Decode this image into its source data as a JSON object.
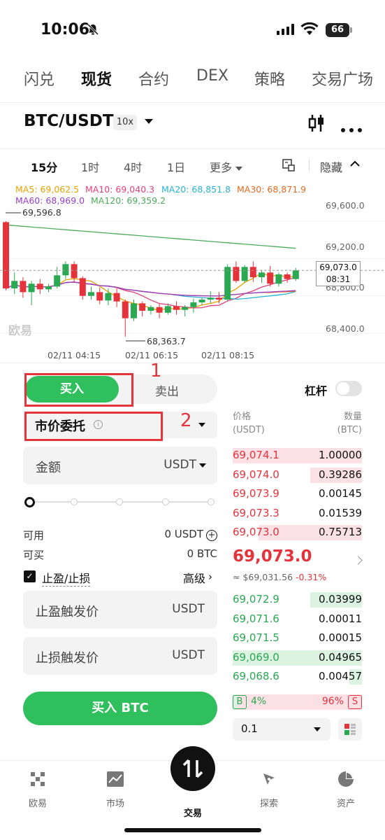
{
  "status_bar": {
    "time": "10:06",
    "battery": "66"
  },
  "top_tabs": [
    "闪兑",
    "现货",
    "合约",
    "DEX",
    "策略",
    "交易广场"
  ],
  "header": {
    "pair": "BTC/USDT",
    "leverage": "10x"
  },
  "timeframes": {
    "items": [
      "15分",
      "1时",
      "4时",
      "1日",
      "更多"
    ],
    "hide_label": "隐藏"
  },
  "ma_legend": {
    "ma5": "MA5: 69,062.5",
    "ma10": "MA10: 69,040.3",
    "ma20": "MA20: 68,851.8",
    "ma30": "MA30: 68,871.9",
    "ma60": "MA60: 68,969.0",
    "ma120": "MA120: 69,359.2"
  },
  "colors": {
    "up": "#2aa852",
    "down": "#e5333b",
    "accent": "#2fbf5c",
    "annotation": "#e5333b"
  },
  "chart_data": {
    "type": "candlestick",
    "y_ticks": [
      "69,600.0",
      "69,200.0",
      "68,800.0",
      "68,400.0"
    ],
    "x_ticks": [
      "02/11 04:15",
      "02/11 06:15",
      "02/11 08:15"
    ],
    "ylim": [
      68250,
      69750
    ],
    "high_label": "69,596.8",
    "low_label": "68,363.7",
    "current_price": "69,073.0",
    "countdown": "08:31",
    "watermark": "欧易",
    "candles": [
      {
        "o": 69590,
        "h": 69600,
        "c": 68880,
        "l": 68860
      },
      {
        "o": 68880,
        "h": 69050,
        "c": 68960,
        "l": 68820
      },
      {
        "o": 68960,
        "h": 69000,
        "c": 68840,
        "l": 68780
      },
      {
        "o": 68840,
        "h": 68960,
        "c": 68930,
        "l": 68700
      },
      {
        "o": 68930,
        "h": 68980,
        "c": 68870,
        "l": 68820
      },
      {
        "o": 68870,
        "h": 68930,
        "c": 68900,
        "l": 68840
      },
      {
        "o": 68900,
        "h": 69110,
        "c": 69020,
        "l": 68880
      },
      {
        "o": 69020,
        "h": 69170,
        "c": 69140,
        "l": 68980
      },
      {
        "o": 69140,
        "h": 69170,
        "c": 68990,
        "l": 68940
      },
      {
        "o": 68990,
        "h": 69010,
        "c": 68800,
        "l": 68760
      },
      {
        "o": 68800,
        "h": 68900,
        "c": 68840,
        "l": 68760
      },
      {
        "o": 68840,
        "h": 68890,
        "c": 68750,
        "l": 68710
      },
      {
        "o": 68750,
        "h": 68880,
        "c": 68830,
        "l": 68700
      },
      {
        "o": 68830,
        "h": 68880,
        "c": 68740,
        "l": 68680
      },
      {
        "o": 68740,
        "h": 68760,
        "c": 68560,
        "l": 68364
      },
      {
        "o": 68560,
        "h": 68760,
        "c": 68720,
        "l": 68530
      },
      {
        "o": 68720,
        "h": 68740,
        "c": 68640,
        "l": 68580
      },
      {
        "o": 68640,
        "h": 68700,
        "c": 68680,
        "l": 68600
      },
      {
        "o": 68680,
        "h": 68720,
        "c": 68620,
        "l": 68560
      },
      {
        "o": 68620,
        "h": 68720,
        "c": 68690,
        "l": 68600
      },
      {
        "o": 68690,
        "h": 68740,
        "c": 68650,
        "l": 68600
      },
      {
        "o": 68650,
        "h": 68700,
        "c": 68680,
        "l": 68580
      },
      {
        "o": 68680,
        "h": 68770,
        "c": 68730,
        "l": 68620
      },
      {
        "o": 68730,
        "h": 68780,
        "c": 68760,
        "l": 68700
      },
      {
        "o": 68760,
        "h": 68850,
        "c": 68780,
        "l": 68720
      },
      {
        "o": 68780,
        "h": 68840,
        "c": 68760,
        "l": 68720
      },
      {
        "o": 68760,
        "h": 69140,
        "c": 69110,
        "l": 68740
      },
      {
        "o": 69110,
        "h": 69170,
        "c": 68960,
        "l": 68940
      },
      {
        "o": 68960,
        "h": 69130,
        "c": 69110,
        "l": 68940
      },
      {
        "o": 69110,
        "h": 69170,
        "c": 69000,
        "l": 68950
      },
      {
        "o": 69000,
        "h": 69080,
        "c": 69050,
        "l": 68940
      },
      {
        "o": 69050,
        "h": 69120,
        "c": 68930,
        "l": 68900
      },
      {
        "o": 68930,
        "h": 69050,
        "c": 69030,
        "l": 68900
      },
      {
        "o": 69030,
        "h": 69050,
        "c": 68980,
        "l": 68940
      },
      {
        "o": 68980,
        "h": 69100,
        "c": 69073,
        "l": 68960
      }
    ]
  },
  "trade_panel": {
    "buy_label": "买入",
    "sell_label": "卖出",
    "leverage_label": "杠杆",
    "order_type": "市价委托",
    "amount_label": "金额",
    "amount_unit": "USDT",
    "available_label": "可用",
    "available_value": "0 USDT",
    "buyable_label": "可买",
    "buyable_value": "0 BTC",
    "tpsl_label": "止盈/止损",
    "advanced_label": "高级",
    "tp_label": "止盈触发价",
    "tp_unit": "USDT",
    "sl_label": "止损触发价",
    "sl_unit": "USDT",
    "submit_label": "买入 BTC",
    "slider_level": 0
  },
  "annotations": [
    "1",
    "2"
  ],
  "order_book": {
    "price_header": "价格",
    "price_unit": "(USDT)",
    "qty_header": "数量",
    "qty_unit": "(BTC)",
    "asks": [
      {
        "price": "69,074.1",
        "qty": "1.00000",
        "depth": 1.0
      },
      {
        "price": "69,074.0",
        "qty": "0.39286",
        "depth": 0.4
      },
      {
        "price": "69,073.9",
        "qty": "0.00145",
        "depth": 0.0
      },
      {
        "price": "69,073.3",
        "qty": "0.01539",
        "depth": 0.0
      },
      {
        "price": "69,073.0",
        "qty": "0.75713",
        "depth": 0.8
      }
    ],
    "last_price": "69,073.0",
    "approx": "≈ $69,031.56",
    "change": "-0.31%",
    "bids": [
      {
        "price": "69,072.9",
        "qty": "0.03999",
        "depth": 0.4
      },
      {
        "price": "69,071.6",
        "qty": "0.00011",
        "depth": 0.0
      },
      {
        "price": "69,071.5",
        "qty": "0.00015",
        "depth": 0.0
      },
      {
        "price": "69,069.0",
        "qty": "0.04965",
        "depth": 1.0
      },
      {
        "price": "69,068.6",
        "qty": "0.00457",
        "depth": 0.1
      }
    ],
    "buy_badge": "B",
    "buy_pct": "4%",
    "sell_pct": "96%",
    "sell_badge": "S",
    "buy_ratio": 0.04,
    "depth_value": "0.1"
  },
  "bottom_nav": [
    "欧易",
    "市场",
    "交易",
    "探索",
    "资产"
  ]
}
